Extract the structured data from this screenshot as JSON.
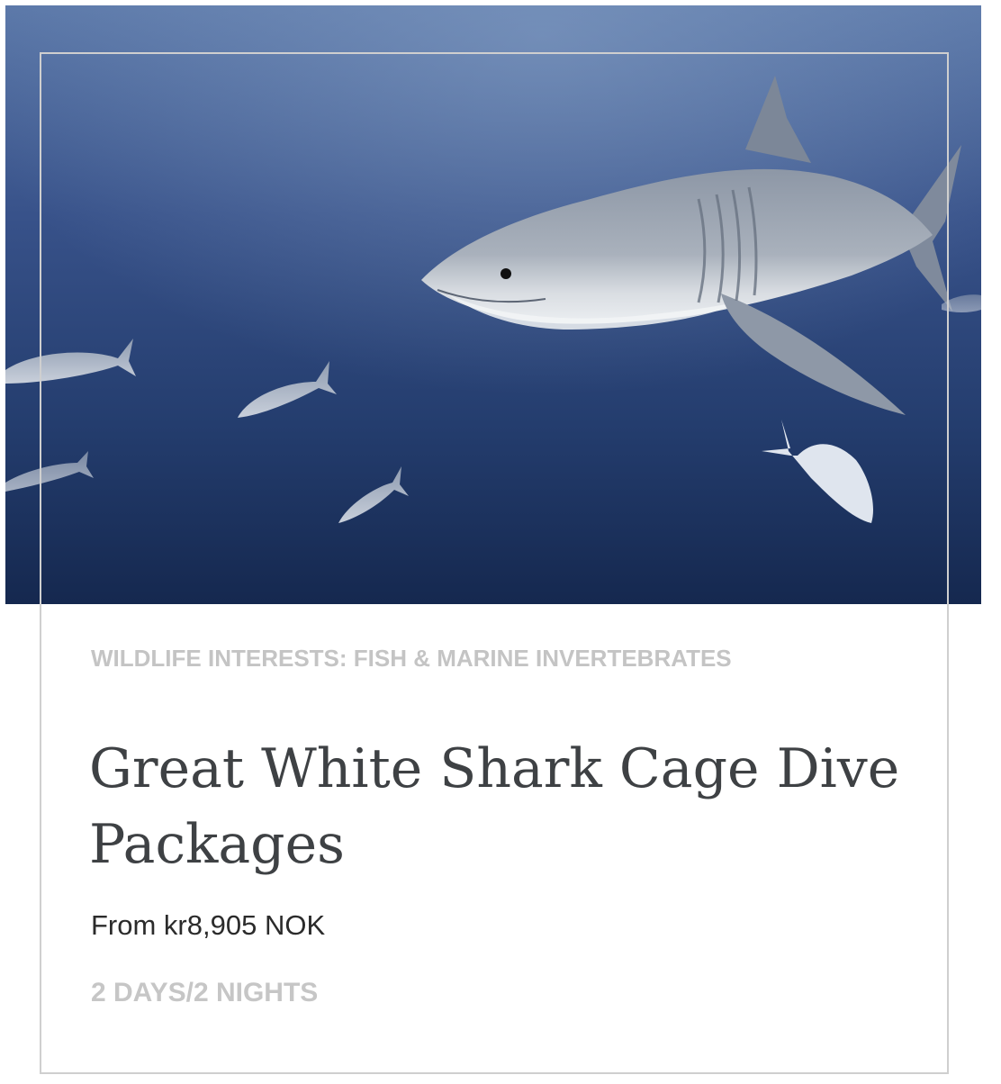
{
  "card": {
    "image_alt": "great-white-shark-photo",
    "category": "WILDLIFE INTERESTS: FISH & MARINE INVERTEBRATES",
    "title": "Great White Shark Cage Dive Packages",
    "price": "From kr8,905 NOK",
    "duration": "2 DAYS/2 NIGHTS"
  },
  "colors": {
    "water_top": "#5672a3",
    "water_bottom": "#172a52",
    "category_text": "#c4c4c4",
    "title_text": "#3e4144",
    "price_text": "#2b2b2b",
    "duration_text": "#c6c6c6",
    "frame_border": "#cfcfcf"
  }
}
